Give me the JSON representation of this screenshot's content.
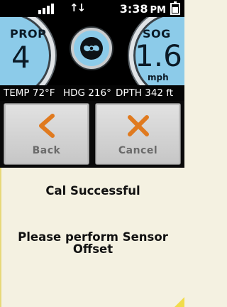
{
  "status_bar": {
    "time": "3:38",
    "ampm": "PM",
    "signal_icon": "signal-bars-icon",
    "data_icon": "up-down-arrows-icon",
    "battery_icon": "battery-icon"
  },
  "gauges": {
    "left": {
      "label": "PROP",
      "value": "4"
    },
    "center_icon": "propeller-icon",
    "right": {
      "label": "SOG",
      "value": "1.6",
      "unit": "mph"
    }
  },
  "readout": {
    "temp": "TEMP 72°F",
    "heading": "HDG 216°",
    "depth": "DPTH  342 ft"
  },
  "buttons": {
    "back": {
      "label": "Back",
      "icon": "chevron-left-icon"
    },
    "cancel": {
      "label": "Cancel",
      "icon": "close-x-icon"
    }
  },
  "message": {
    "line1": "Cal Successful",
    "line2": "Please perform Sensor",
    "line3": "Offset"
  },
  "colors": {
    "gauge_blue": "#8ccbe9",
    "accent_orange": "#e07a1f",
    "panel_cream": "#f4f1e1",
    "corner_yellow": "#f1dc4a"
  }
}
